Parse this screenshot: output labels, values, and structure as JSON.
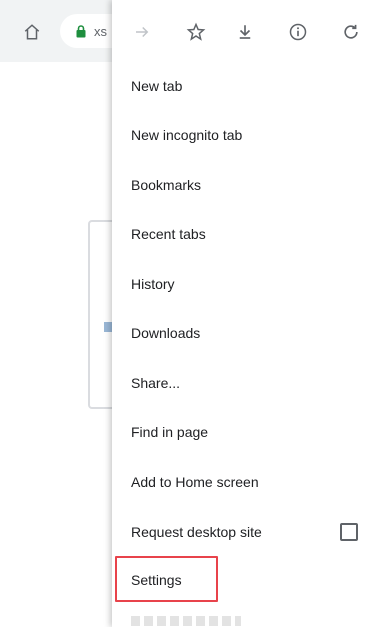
{
  "toolbar": {
    "url_text": "xs"
  },
  "menu": {
    "icons": [
      "forward-icon",
      "star-icon",
      "download-icon",
      "info-icon",
      "refresh-icon"
    ],
    "items": [
      {
        "label": "New tab"
      },
      {
        "label": "New incognito tab"
      },
      {
        "label": "Bookmarks"
      },
      {
        "label": "Recent tabs"
      },
      {
        "label": "History"
      },
      {
        "label": "Downloads"
      },
      {
        "label": "Share..."
      },
      {
        "label": "Find in page"
      },
      {
        "label": "Add to Home screen"
      },
      {
        "label": "Request desktop site",
        "checked": false
      },
      {
        "label": "Settings",
        "highlighted": true
      }
    ]
  },
  "colors": {
    "lock_green": "#1e8e3e",
    "highlight_red": "#e8434b",
    "icon_gray": "#5f6368"
  }
}
